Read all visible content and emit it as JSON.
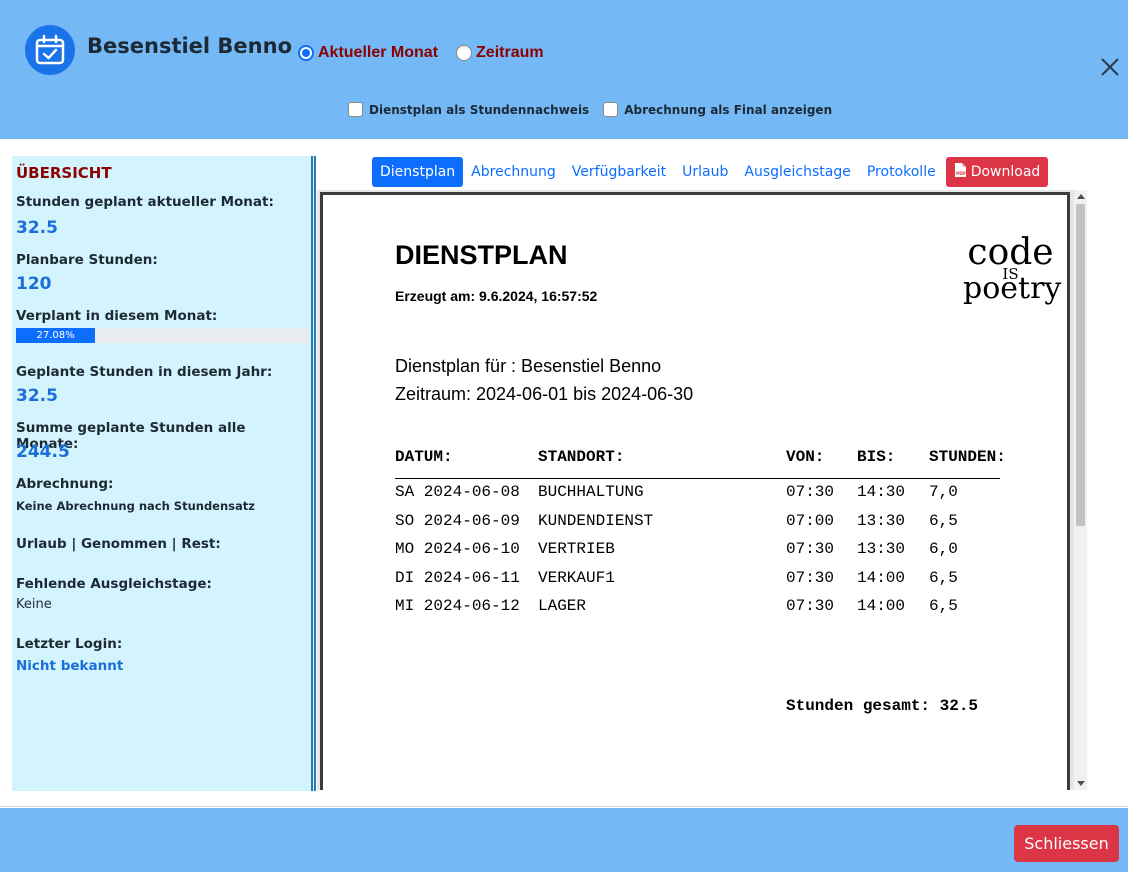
{
  "header": {
    "user_name": "Besenstiel Benno",
    "radio_current_month": "Aktueller Monat",
    "radio_period": "Zeitraum",
    "checkbox_schedule_as_proof": "Dienstplan als Stundennachweis",
    "checkbox_billing_final": "Abrechnung als Final anzeigen",
    "selected_radio": "Aktueller Monat"
  },
  "sidebar": {
    "title": "ÜBERSICHT",
    "hours_planned_current_label": "Stunden geplant aktueller Monat:",
    "hours_planned_current_value": "32.5",
    "plannable_hours_label": "Planbare Stunden:",
    "plannable_hours_value": "120",
    "planned_this_month_label": "Verplant in diesem Monat:",
    "planned_this_month_percent_text": "27.08%",
    "planned_this_month_fraction": 0.2708,
    "planned_year_label": "Geplante Stunden in diesem Jahr:",
    "planned_year_value": "32.5",
    "sum_all_months_label": "Summe geplante Stunden alle Monate:",
    "sum_all_months_value": "244.5",
    "billing_label": "Abrechnung:",
    "billing_value": "Keine Abrechnung nach Stundensatz",
    "vacation_label": "Urlaub | Genommen | Rest:",
    "missing_comp_days_label": "Fehlende Ausgleichstage:",
    "missing_comp_days_value": "Keine",
    "last_login_label": "Letzter Login:",
    "last_login_value": "Nicht bekannt"
  },
  "tabs": [
    {
      "label": "Dienstplan",
      "active": true
    },
    {
      "label": "Abrechnung",
      "active": false
    },
    {
      "label": "Verfügbarkeit",
      "active": false
    },
    {
      "label": "Urlaub",
      "active": false
    },
    {
      "label": "Ausgleichstage",
      "active": false
    },
    {
      "label": "Protokolle",
      "active": false
    }
  ],
  "download_label": "Download",
  "document": {
    "title": "DIENSTPLAN",
    "created": "Erzeugt am: 9.6.2024, 16:57:52",
    "plan_for": "Dienstplan für : Besenstiel Benno",
    "period": "Zeitraum: 2024-06-01 bis 2024-06-30",
    "logo": {
      "line1": "code",
      "line2": "IS",
      "line3": "poetry"
    },
    "columns": [
      "DATUM:",
      "STANDORT:",
      "VON:",
      "BIS:",
      "STUNDEN:"
    ],
    "rows": [
      {
        "date": "SA 2024-06-08",
        "location": "BUCHHALTUNG",
        "from": "07:30",
        "to": "14:30",
        "hours": "7,0"
      },
      {
        "date": "SO 2024-06-09",
        "location": "KUNDENDIENST",
        "from": "07:00",
        "to": "13:30",
        "hours": "6,5"
      },
      {
        "date": "MO 2024-06-10",
        "location": "VERTRIEB",
        "from": "07:30",
        "to": "13:30",
        "hours": "6,0"
      },
      {
        "date": "DI 2024-06-11",
        "location": "VERKAUF1",
        "from": "07:30",
        "to": "14:00",
        "hours": "6,5"
      },
      {
        "date": "MI 2024-06-12",
        "location": "LAGER",
        "from": "07:30",
        "to": "14:00",
        "hours": "6,5"
      }
    ],
    "total": "Stunden gesamt: 32.5"
  },
  "footer": {
    "close_label": "Schliessen"
  },
  "colors": {
    "header_bg": "#74b8f5",
    "sidebar_bg": "#d4f4fd",
    "primary": "#0d6efd",
    "danger": "#dc3545",
    "dark_red": "#8b0000"
  }
}
